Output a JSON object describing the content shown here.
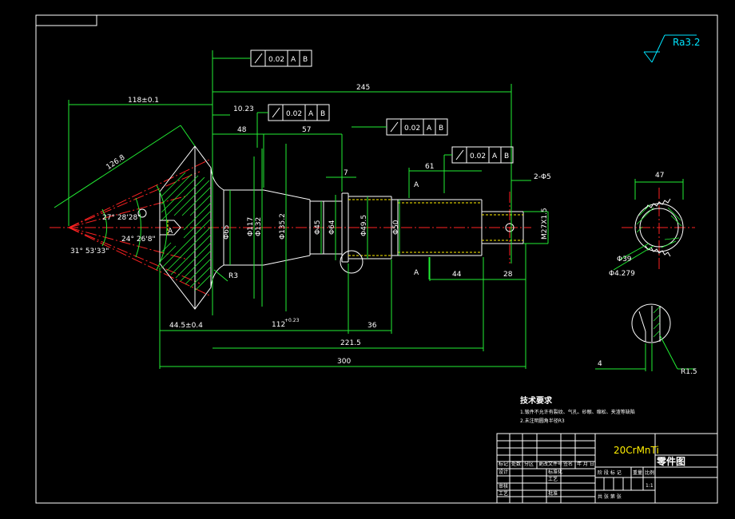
{
  "roughness": {
    "symbol": "Ra3.2"
  },
  "tolerance_frames": [
    {
      "value": "0.02",
      "datum_a": "A",
      "datum_b": "B"
    },
    {
      "value": "0.02",
      "datum_a": "A",
      "datum_b": "B"
    },
    {
      "value": "0.02",
      "datum_a": "A",
      "datum_b": "B"
    },
    {
      "value": "0.02",
      "datum_a": "A",
      "datum_b": "B"
    }
  ],
  "dimensions": {
    "d245": "245",
    "d118": "118±0.1",
    "d10_23": "10.23",
    "d48": "48",
    "d57": "57",
    "d7": "7",
    "d61": "61",
    "d2_65": "2-Φ5",
    "d126_8": "126.8",
    "angle_27": "27° 28'28\"",
    "angle_24": "24° 26'8\"",
    "angle_31": "31° 53'33\"",
    "dia_65": "Φ65",
    "dia_117": "Φ117",
    "dia_132": "Φ132",
    "dia_135_2": "Φ135.2",
    "dia_45": "Φ45",
    "dia_64": "Φ64",
    "dia_49_5": "Φ49.5",
    "dia_50": "Φ50",
    "thread": "M27X1.5",
    "r3": "R3",
    "d44_5": "44.5±0.4",
    "d112": "112",
    "d112_tol": "+0.23",
    "d36": "36",
    "d221_5": "221.5",
    "d300": "300",
    "d44": "44",
    "d28": "28",
    "d47": "47",
    "dia_39": "Φ39",
    "dia_4_279": "Φ4.279",
    "d4": "4",
    "r1_5": "R1.5",
    "datum_a": "A",
    "datum_b": "B"
  },
  "notes": {
    "title": "技术要求",
    "line1": "1.锻件不允许有裂纹、气孔、砂眼、缩松、夹渣等缺陷",
    "line2": "2.未注明圆角半径R3"
  },
  "title_block": {
    "material": "20CrMnTi",
    "part_name": "零件图",
    "scale": "1:1",
    "labels": {
      "mark": "标记",
      "count": "处数",
      "zone": "分区",
      "doc": "更改文件号",
      "sign": "签名",
      "date": "年 月 日",
      "design": "设计",
      "standard": "标准化",
      "stage": "阶 段 标 记",
      "weight": "重量",
      "ratio": "比例",
      "review": "审核",
      "process": "工艺",
      "approve": "批准",
      "craft": "工艺",
      "total": "共  张 第  张"
    }
  }
}
